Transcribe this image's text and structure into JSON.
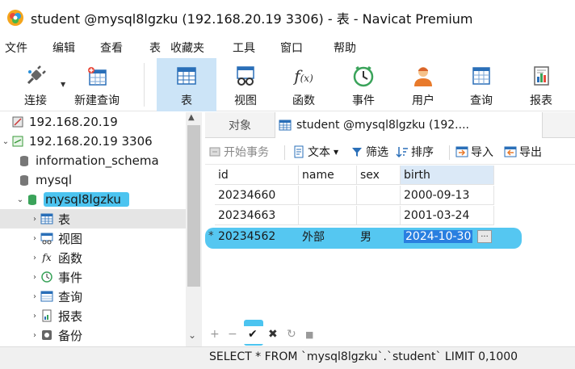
{
  "window": {
    "title": "student @mysql8lgzku (192.168.20.19  3306) - 表 - Navicat Premium"
  },
  "menu": [
    "文件",
    "编辑",
    "查看",
    "表",
    "收藏夹",
    "工具",
    "窗口",
    "帮助"
  ],
  "toolbar": {
    "connect": "连接",
    "new_query": "新建查询",
    "table": "表",
    "view": "视图",
    "function": "函数",
    "event": "事件",
    "user": "用户",
    "query": "查询",
    "report": "报表"
  },
  "tree": {
    "conn1": "192.168.20.19",
    "conn2": "192.168.20.19  3306",
    "db_info": "information_schema",
    "db_mysql": "mysql",
    "db_active": "mysql8lgzku",
    "node_table": "表",
    "node_view": "视图",
    "node_function": "函数",
    "node_event": "事件",
    "node_query": "查询",
    "node_report": "报表",
    "node_backup": "备份"
  },
  "tabs": {
    "objects": "对象",
    "active": "student @mysql8lgzku (192...."
  },
  "subtoolbar": {
    "begin_tx": "开始事务",
    "text": "文本",
    "filter": "筛选",
    "sort": "排序",
    "import": "导入",
    "export": "导出"
  },
  "grid": {
    "columns": [
      "id",
      "name",
      "sex",
      "birth"
    ],
    "rows": [
      {
        "marker": "",
        "id": "20234660",
        "name": "",
        "sex": "",
        "birth": "2000-09-13"
      },
      {
        "marker": "",
        "id": "20234663",
        "name": "",
        "sex": "",
        "birth": "2001-03-24"
      },
      {
        "marker": "*",
        "id": "20234562",
        "name": "外部",
        "sex": "男",
        "birth": "2024-10-30"
      }
    ],
    "edit_button": "···"
  },
  "bottom_controls": {
    "add": "+",
    "remove": "−",
    "apply": "✔",
    "discard": "✖",
    "refresh": "↻",
    "stop": "■"
  },
  "status": {
    "sql": "SELECT * FROM `mysql8lgzku`.`student` LIMIT 0,1000"
  },
  "colors": {
    "accent": "#4cc4f0",
    "selection": "#2a7fe0",
    "active_tool": "#cce4f7"
  }
}
